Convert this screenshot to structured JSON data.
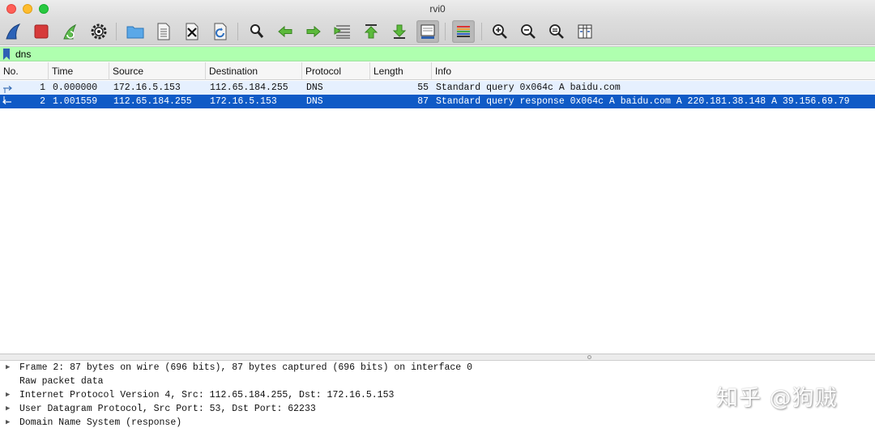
{
  "window": {
    "title": "rvi0"
  },
  "toolbar": {
    "buttons": [
      "start-capture",
      "stop-capture",
      "restart-capture",
      "capture-options",
      "open-file",
      "save-file",
      "close-file",
      "reload-file",
      "find-packet",
      "go-back",
      "go-forward",
      "go-to-packet",
      "go-first",
      "go-last",
      "auto-scroll",
      "colorize",
      "zoom-in",
      "zoom-out",
      "normal-size",
      "resize-columns"
    ]
  },
  "filter": {
    "value": "dns"
  },
  "packet_list": {
    "columns": [
      "No.",
      "Time",
      "Source",
      "Destination",
      "Protocol",
      "Length",
      "Info"
    ],
    "rows": [
      {
        "no": "1",
        "time": "0.000000",
        "source": "172.16.5.153",
        "destination": "112.65.184.255",
        "protocol": "DNS",
        "length": "55",
        "info": "Standard query 0x064c A baidu.com"
      },
      {
        "no": "2",
        "time": "1.001559",
        "source": "112.65.184.255",
        "destination": "172.16.5.153",
        "protocol": "DNS",
        "length": "87",
        "info": "Standard query response 0x064c A baidu.com A 220.181.38.148 A 39.156.69.79"
      }
    ]
  },
  "details": [
    {
      "expander": "▶",
      "text": "Frame 2: 87 bytes on wire (696 bits), 87 bytes captured (696 bits) on interface 0"
    },
    {
      "expander": "",
      "text": "Raw packet data"
    },
    {
      "expander": "▶",
      "text": "Internet Protocol Version 4, Src: 112.65.184.255, Dst: 172.16.5.153"
    },
    {
      "expander": "▶",
      "text": "User Datagram Protocol, Src Port: 53, Dst Port: 62233"
    },
    {
      "expander": "▶",
      "text": "Domain Name System (response)"
    }
  ],
  "watermark": "知乎 @狗贼",
  "colors": {
    "filter_valid": "#afffaf",
    "selected_row": "#0f5ac6",
    "row_alt": "#e6f0fe"
  }
}
